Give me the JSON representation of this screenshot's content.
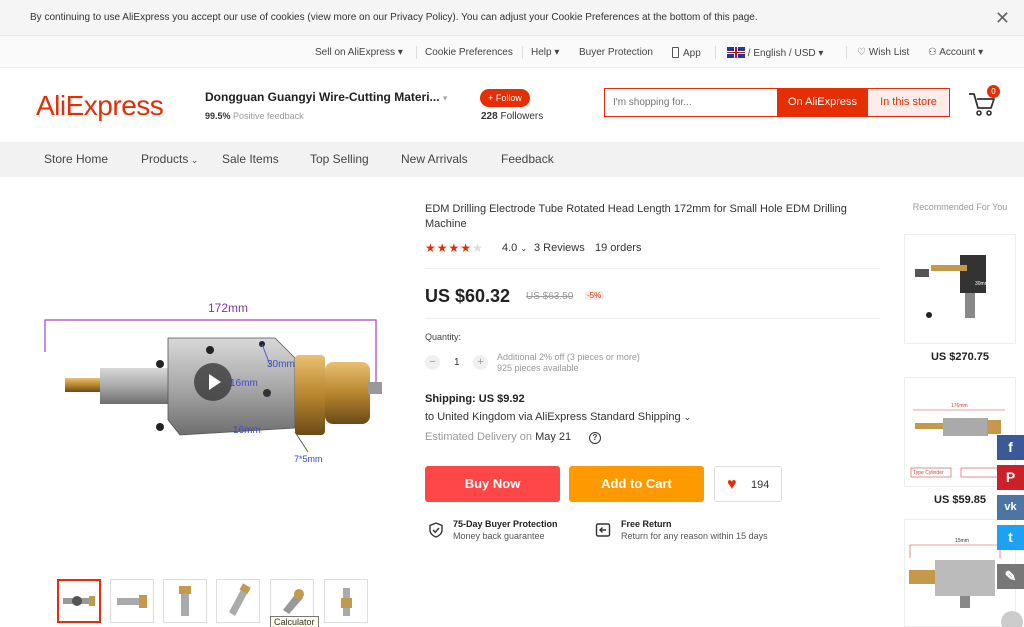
{
  "cookie_banner": {
    "text": "By continuing to use AliExpress you accept our use of cookies (view more on our Privacy Policy). You can adjust your Cookie Preferences at the bottom of this page.",
    "close_glyph": "✕"
  },
  "top_nav": {
    "sell": "Sell on AliExpress",
    "cookie_prefs": "Cookie Preferences",
    "help": "Help",
    "buyer_protection": "Buyer Protection",
    "app": "App",
    "language_currency": "/ English / USD",
    "wish_list": "Wish List",
    "account": "Account"
  },
  "header": {
    "logo": "AliExpress",
    "store_name": "Dongguan Guangyi Wire-Cutting Materi...",
    "feedback_pct": "99.5%",
    "feedback_label": "Positive feedback",
    "follow_label": "+ Follow",
    "followers_count": "228",
    "followers_label": "Followers",
    "search_placeholder": "I'm shopping for...",
    "search_btn_ali": "On AliExpress",
    "search_btn_store": "In this store",
    "cart_count": "0",
    "brand_color": "#e62e04"
  },
  "store_nav": [
    "Store Home",
    "Products",
    "Sale Items",
    "Top Selling",
    "New Arrivals",
    "Feedback"
  ],
  "gallery": {
    "labels": {
      "length": "172mm",
      "d1": "30mm",
      "d2": "16mm",
      "d3": "16mm",
      "size": "7*5mm"
    },
    "tooltip": "Calculator",
    "thumb_count": 6
  },
  "product": {
    "title": "EDM Drilling Electrode Tube Rotated Head Length 172mm for Small Hole EDM Drilling Machine",
    "stars": "★★★★★",
    "rating": "4.0",
    "rating_value": 4.0,
    "reviews": "3 Reviews",
    "orders": "19 orders",
    "price": "US $60.32",
    "old_price": "US $63.50",
    "discount": "-5%",
    "quantity_label": "Quantity:",
    "qty_minus": "−",
    "qty_plus": "+",
    "quantity": "1",
    "qty_note1": "Additional 2% off (3 pieces or more)",
    "qty_note2": "925 pieces available",
    "shipping_cost": "Shipping: US $9.92",
    "shipping_to": "to United Kingdom via AliExpress Standard Shipping",
    "delivery_label": "Estimated Delivery on",
    "delivery_date": "May 21",
    "buy_now": "Buy Now",
    "add_to_cart": "Add to Cart",
    "wishlist_count": "194",
    "protection_title": "75-Day Buyer Protection",
    "protection_sub": "Money back guarantee",
    "return_title": "Free Return",
    "return_sub": "Return for any reason within 15 days"
  },
  "recommended": {
    "title": "Recommended For You",
    "items": [
      {
        "price": "US $270.75"
      },
      {
        "price": "US $59.85"
      }
    ],
    "labels": {
      "a": "30mm",
      "b": "30mm",
      "c": "176mm",
      "d": "Type Cylinder",
      "e": "15mm"
    }
  },
  "social": [
    {
      "name": "facebook",
      "glyph": "f",
      "color": "#3b5998"
    },
    {
      "name": "pinterest",
      "glyph": "P",
      "color": "#cb2027"
    },
    {
      "name": "vk",
      "glyph": "vk",
      "color": "#4c75a3"
    },
    {
      "name": "twitter",
      "glyph": "t",
      "color": "#1da1f2"
    },
    {
      "name": "edit",
      "glyph": "✎",
      "color": "#777777"
    }
  ]
}
